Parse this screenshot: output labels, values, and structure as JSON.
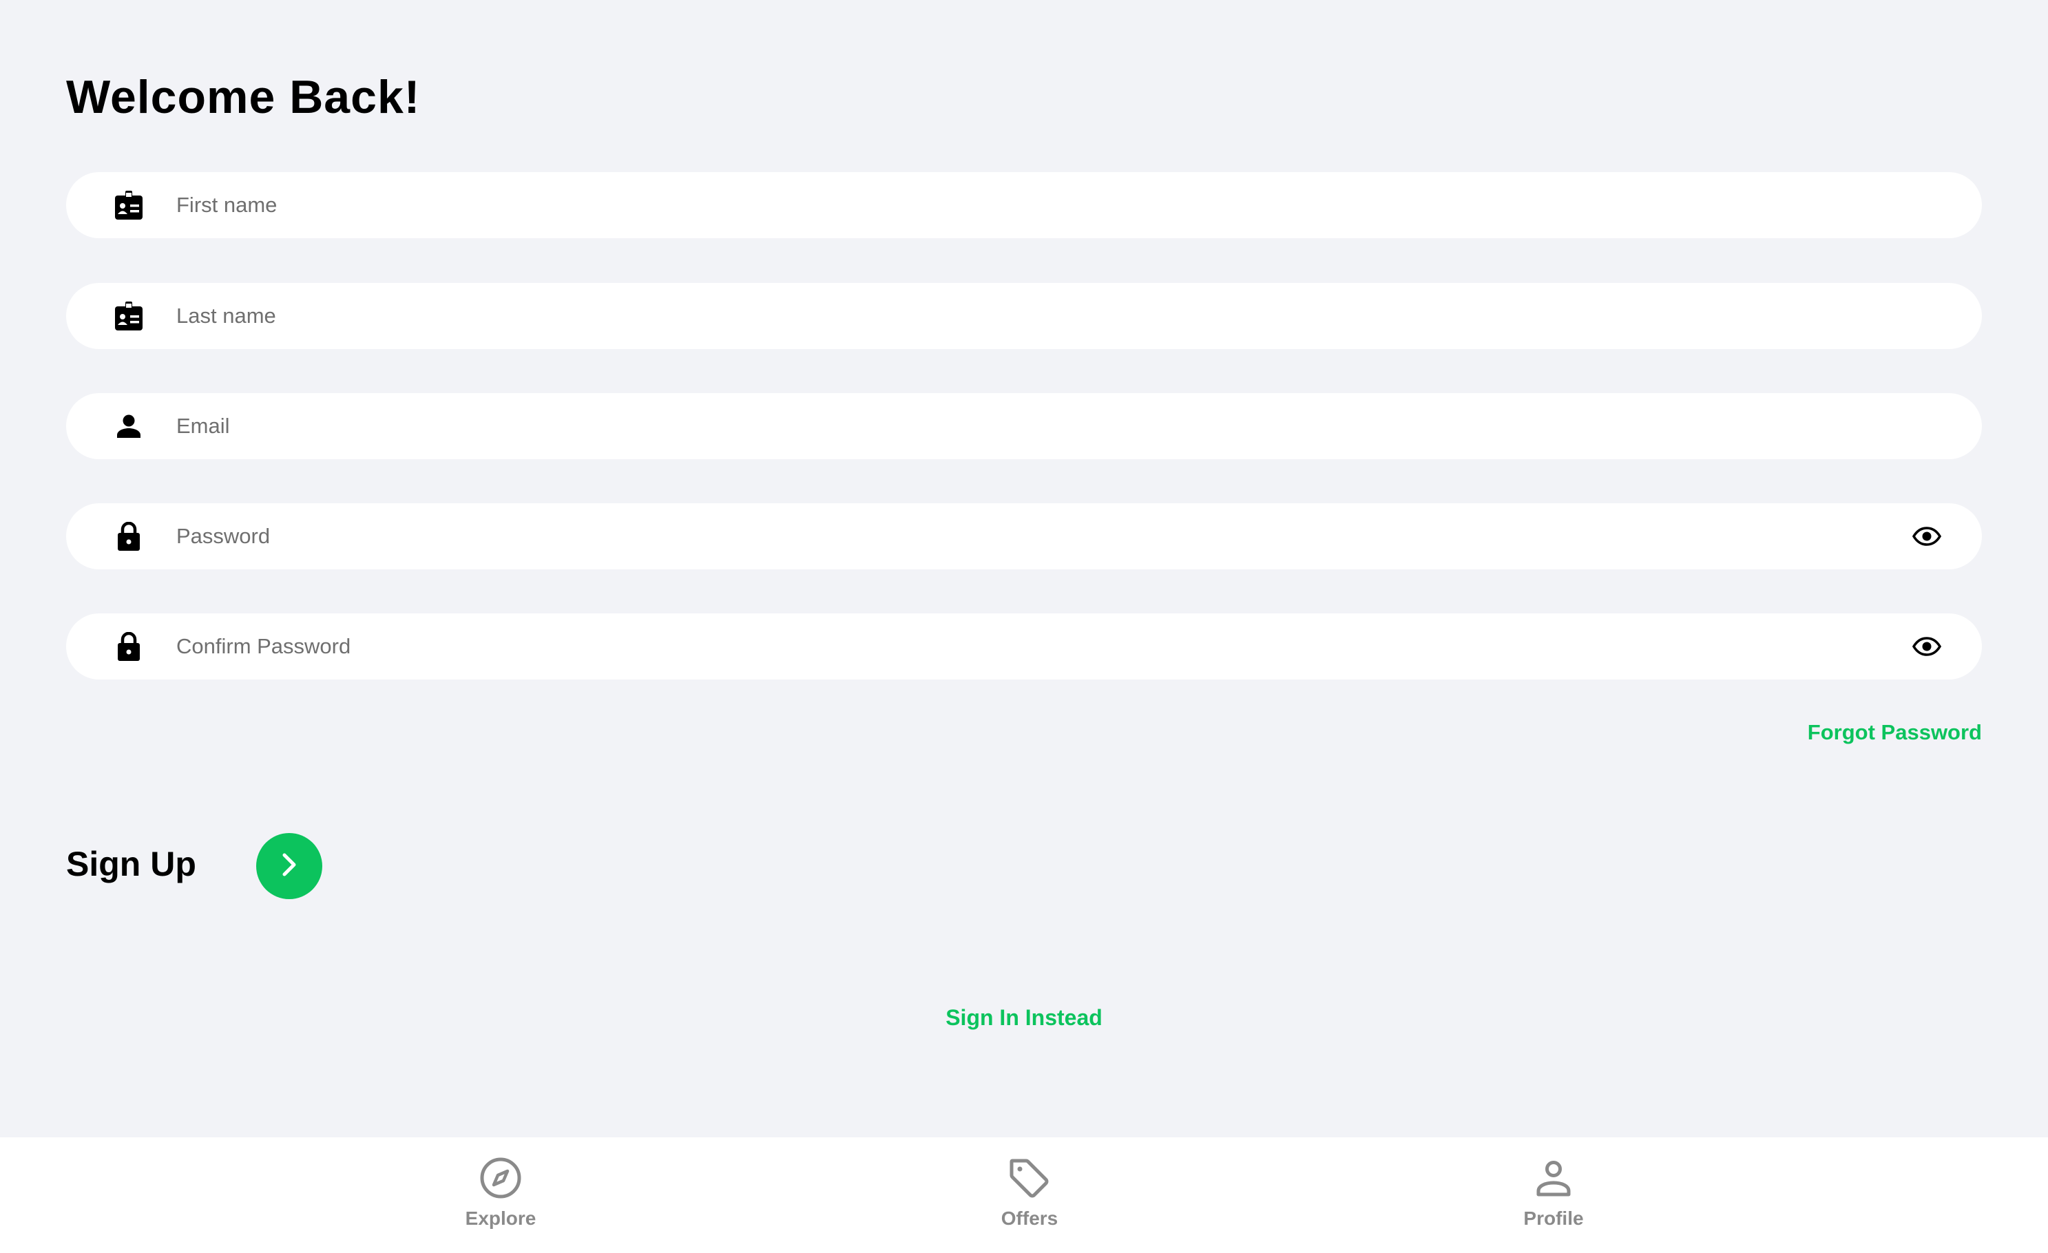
{
  "header": {
    "title": "Welcome Back!"
  },
  "form": {
    "fields": [
      {
        "id": "first_name",
        "placeholder": "First name",
        "value": "",
        "icon": "id-badge-icon"
      },
      {
        "id": "last_name",
        "placeholder": "Last name",
        "value": "",
        "icon": "id-badge-icon"
      },
      {
        "id": "email",
        "placeholder": "Email",
        "value": "",
        "icon": "person-icon"
      },
      {
        "id": "password",
        "placeholder": "Password",
        "value": "",
        "icon": "lock-icon",
        "toggle_icon": "eye-icon"
      },
      {
        "id": "confirm_password",
        "placeholder": "Confirm Password",
        "value": "",
        "icon": "lock-icon",
        "toggle_icon": "eye-icon"
      }
    ],
    "forgot_password_label": "Forgot Password",
    "submit_label": "Sign Up",
    "submit_icon": "chevron-right-icon",
    "alt_action_label": "Sign In Instead"
  },
  "tabbar": {
    "items": [
      {
        "label": "Explore",
        "icon": "compass-icon"
      },
      {
        "label": "Offers",
        "icon": "tag-icon"
      },
      {
        "label": "Profile",
        "icon": "user-icon"
      }
    ]
  },
  "colors": {
    "background": "#f2f3f7",
    "accent": "#0cc35d",
    "field_bg": "#ffffff",
    "tab_inactive": "#8a8a8a"
  }
}
